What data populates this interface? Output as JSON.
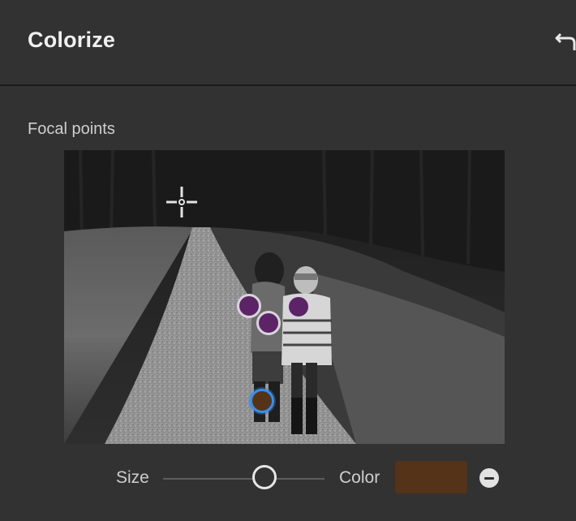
{
  "panel": {
    "title": "Colorize",
    "reset_icon": "undo-icon"
  },
  "focal_section": {
    "label": "Focal points",
    "photo_description_icon": "photo-thumbnail",
    "add_point_icon": "crosshair-icon",
    "points": [
      {
        "name": "focal-point-1",
        "color": "#5c2466",
        "selected": false
      },
      {
        "name": "focal-point-2",
        "color": "#5c2466",
        "selected": false
      },
      {
        "name": "focal-point-3",
        "color": "#5c2466",
        "selected": false
      },
      {
        "name": "focal-point-4",
        "color": "#553318",
        "selected": true
      }
    ]
  },
  "controls": {
    "size_label": "Size",
    "size_value": 0.63,
    "color_label": "Color",
    "color_value": "#553318",
    "remove_icon": "minus-circle-icon"
  }
}
